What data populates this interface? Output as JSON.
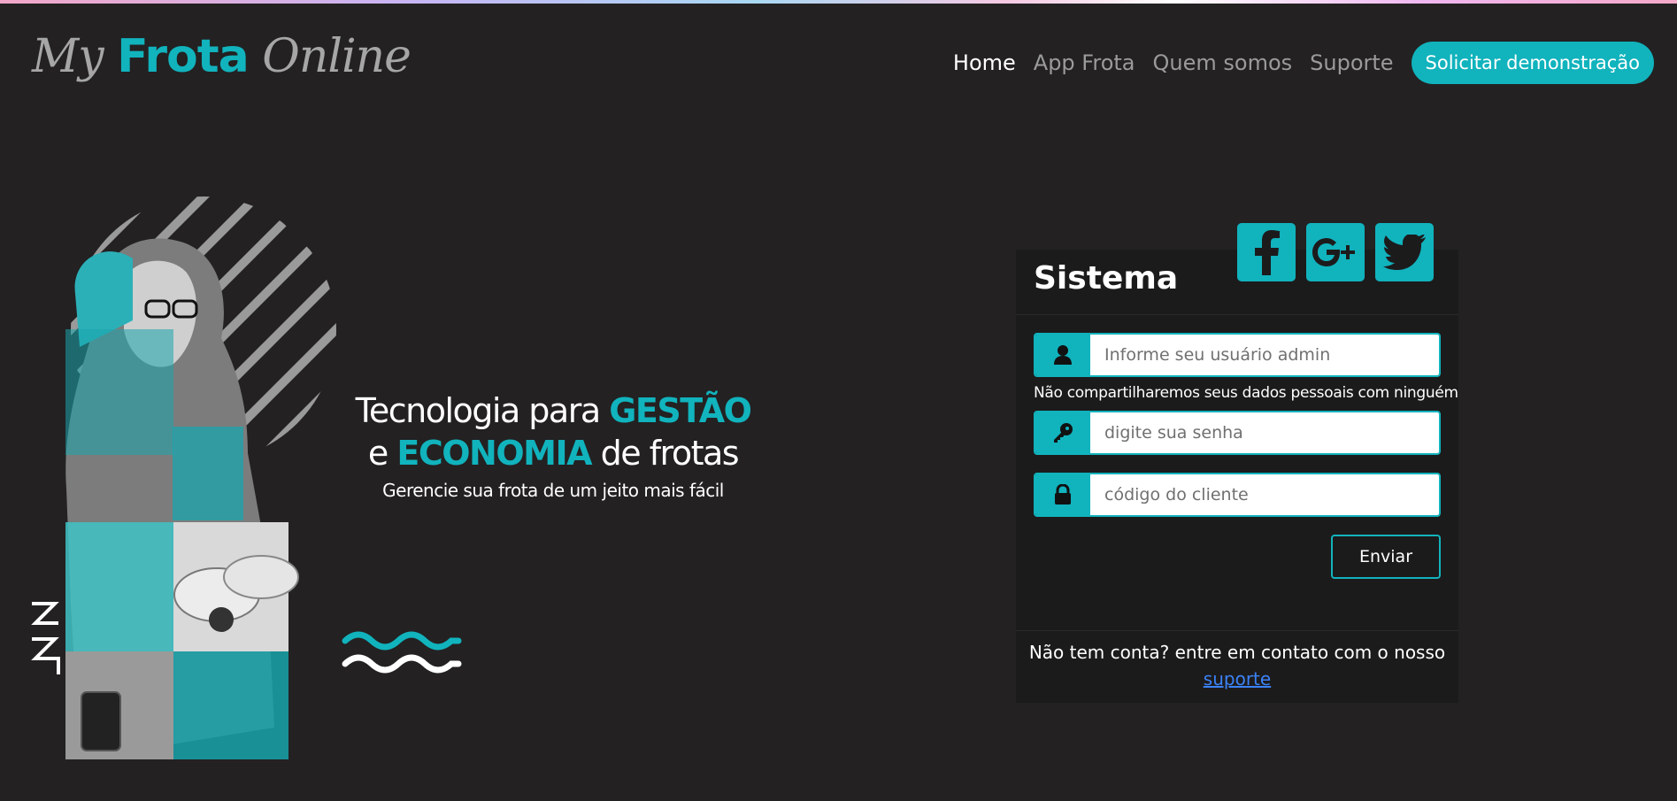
{
  "brand": {
    "logo_part1": "My ",
    "logo_part2": "Frota",
    "logo_part3": " Online"
  },
  "nav": {
    "items": [
      {
        "label": "Home",
        "active": true
      },
      {
        "label": "App Frota",
        "active": false
      },
      {
        "label": "Quem somos",
        "active": false
      },
      {
        "label": "Suporte",
        "active": false
      }
    ],
    "cta_label": "Solicitar demonstração"
  },
  "hero": {
    "line1_text": "Tecnologia para ",
    "line1_accent": "GESTÃO",
    "line2_prefix": "e ",
    "line2_accent": "ECONOMIA",
    "line2_suffix": " de frotas",
    "subtitle": "Gerencie  sua frota de um jeito mais fácil"
  },
  "login": {
    "title": "Sistema",
    "social": [
      "facebook-icon",
      "google-plus-icon",
      "twitter-icon"
    ],
    "user_placeholder": "Informe seu usuário admin",
    "help_text": "Não compartilharemos seus dados pessoais com ninguém",
    "password_placeholder": "digite sua senha",
    "client_code_placeholder": "código do cliente",
    "submit_label": "Enviar",
    "footer_text": "Não tem conta? entre em contato com o nosso",
    "footer_link": "suporte"
  },
  "colors": {
    "accent": "#11b3bd",
    "background": "#232122",
    "panel": "#1c1b1c",
    "link": "#3b82f6"
  }
}
